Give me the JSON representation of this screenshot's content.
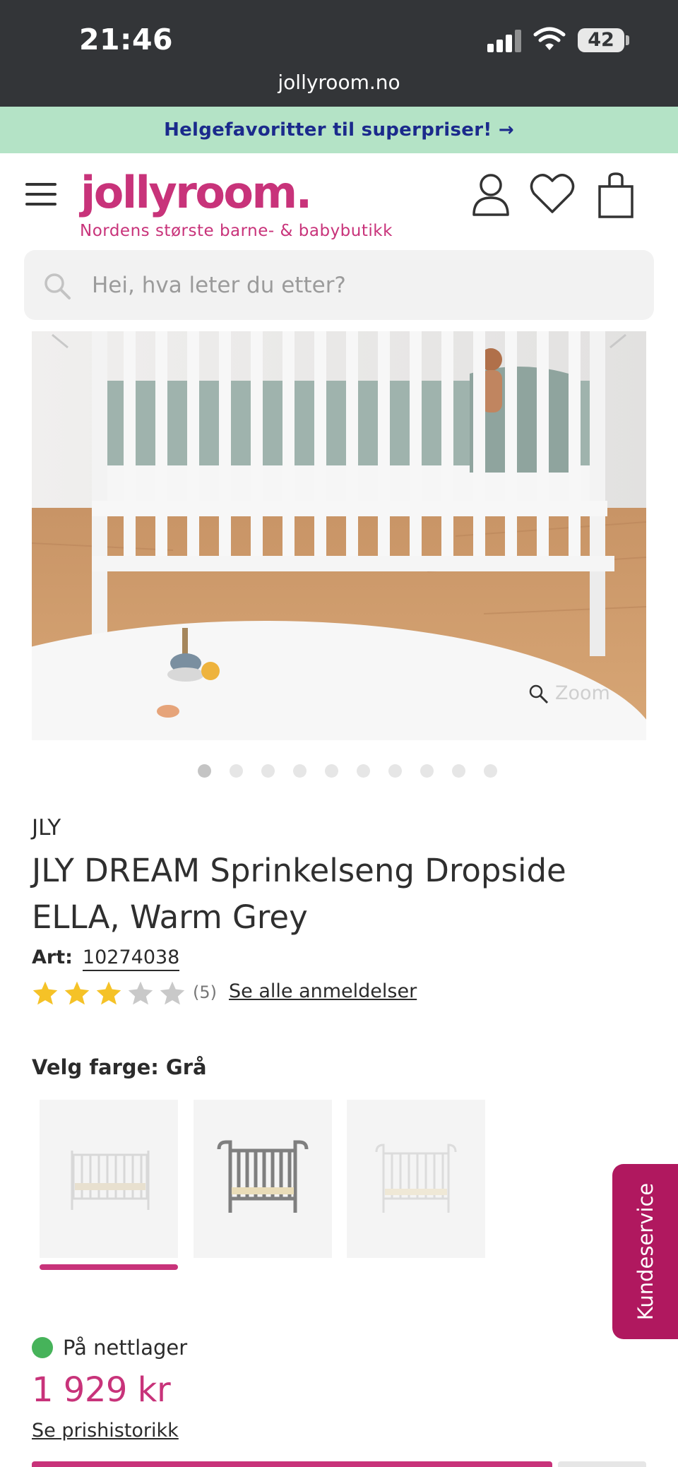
{
  "status_bar": {
    "time": "21:46",
    "battery": "42",
    "url": "jollyroom.no"
  },
  "promo": {
    "text": "Helgefavoritter til superpriser! →"
  },
  "header": {
    "logo": "jollyroom.",
    "tagline": "Nordens største barne- & babybutikk",
    "icons": [
      "menu-icon",
      "account-icon",
      "heart-icon",
      "shopping-bag-icon"
    ]
  },
  "search": {
    "placeholder": "Hei, hva leter du etter?"
  },
  "gallery": {
    "zoom_label": "Zoom",
    "image_count": 10,
    "active_index": 0
  },
  "product": {
    "brand": "JLY",
    "title": "JLY DREAM Sprinkelseng Dropside ELLA, Warm Grey",
    "art_label": "Art:",
    "art_number": "10274038",
    "rating": 3,
    "rating_max": 5,
    "review_count": "(5)",
    "reviews_link": "Se alle anmeldelser"
  },
  "color_select": {
    "label": "Velg farge: Grå",
    "selected_index": 0,
    "options": [
      "white-crib",
      "grey-crib",
      "light-grey-crib"
    ]
  },
  "stock": {
    "text": "På nettlager",
    "color": "#46b35a"
  },
  "price": {
    "value": "1 929 kr",
    "history_link": "Se prishistorikk"
  },
  "support": {
    "label": "Kundeservice"
  },
  "colors": {
    "brand": "#c8337a",
    "promo_bg": "#b4e3c6",
    "promo_text": "#1b2a8c",
    "support_bg": "#b0185f"
  }
}
